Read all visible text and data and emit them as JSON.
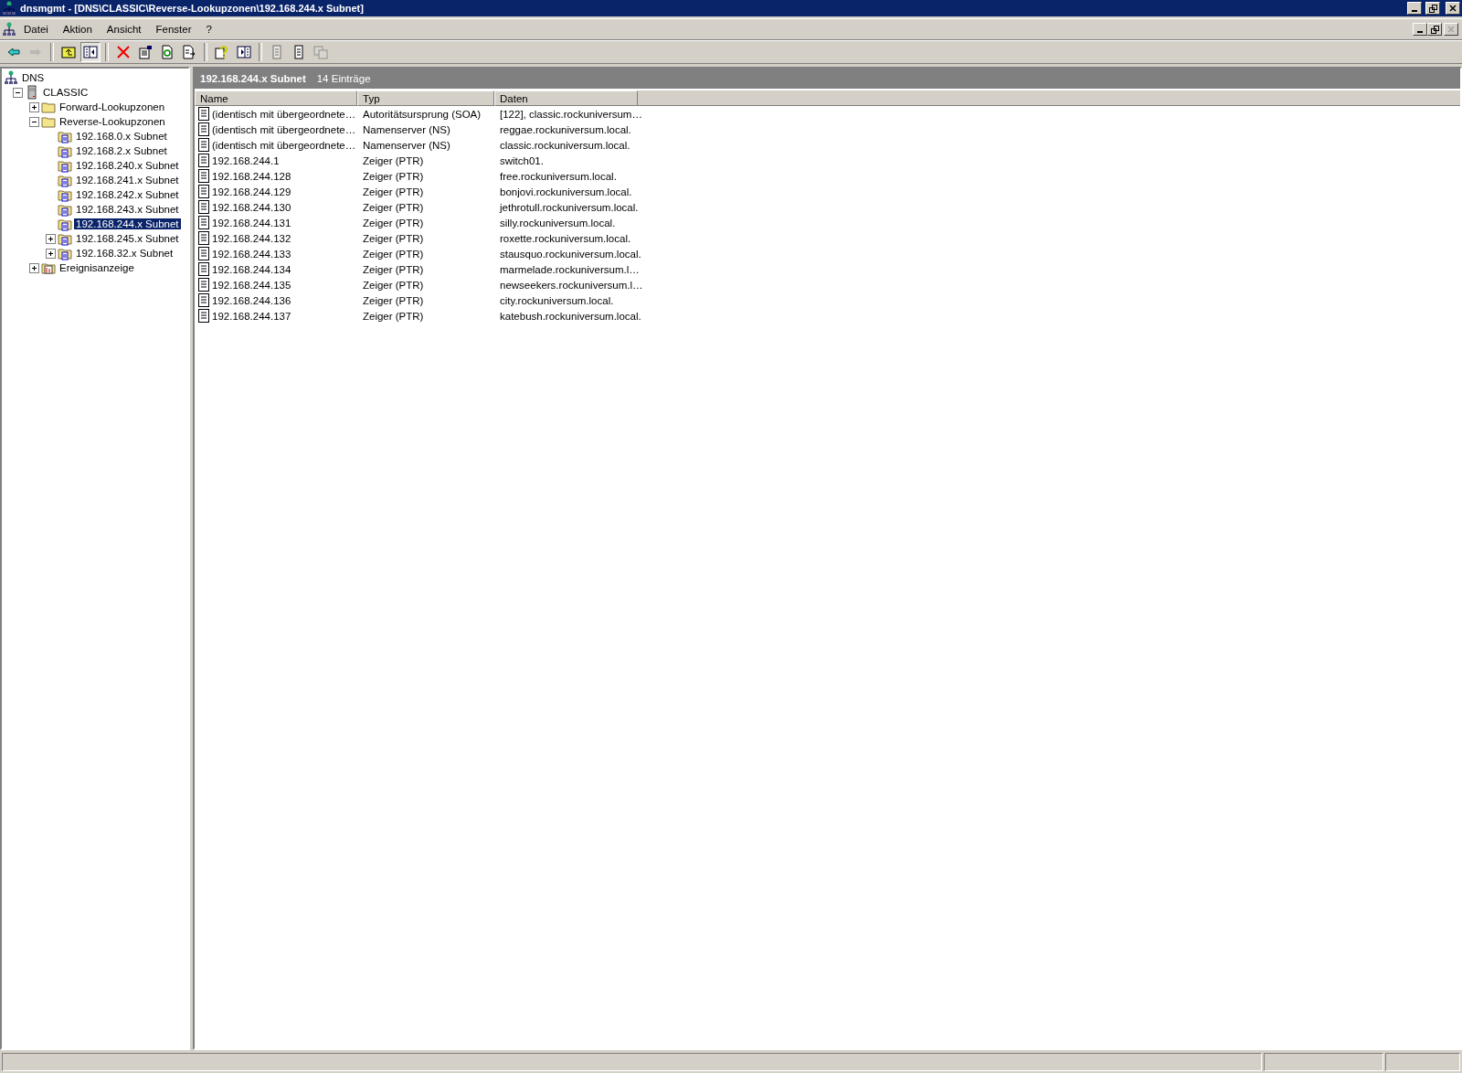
{
  "window": {
    "title": "dnsmgmt - [DNS\\CLASSIC\\Reverse-Lookupzonen\\192.168.244.x Subnet]"
  },
  "menu": [
    "Datei",
    "Aktion",
    "Ansicht",
    "Fenster",
    "?"
  ],
  "toolbar": [
    {
      "kind": "back",
      "disabled": false,
      "pressed": false
    },
    {
      "kind": "forward",
      "disabled": true,
      "pressed": false
    },
    {
      "kind": "sep"
    },
    {
      "kind": "up",
      "disabled": false,
      "pressed": false
    },
    {
      "kind": "tree",
      "disabled": false,
      "pressed": true
    },
    {
      "kind": "sep"
    },
    {
      "kind": "delete",
      "disabled": false,
      "pressed": false
    },
    {
      "kind": "properties",
      "disabled": false,
      "pressed": false
    },
    {
      "kind": "refresh",
      "disabled": false,
      "pressed": false
    },
    {
      "kind": "export",
      "disabled": false,
      "pressed": false
    },
    {
      "kind": "sep"
    },
    {
      "kind": "help",
      "disabled": false,
      "pressed": false
    },
    {
      "kind": "pane",
      "disabled": false,
      "pressed": false
    },
    {
      "kind": "sep"
    },
    {
      "kind": "record",
      "disabled": true,
      "pressed": false
    },
    {
      "kind": "record",
      "disabled": false,
      "pressed": false
    },
    {
      "kind": "copy",
      "disabled": true,
      "pressed": false
    }
  ],
  "tree": [
    {
      "label": "DNS",
      "kind": "root",
      "selected": false,
      "children": [
        {
          "label": "CLASSIC",
          "kind": "server",
          "selected": false,
          "expanded": true,
          "children": [
            {
              "label": "Forward-Lookupzonen",
              "kind": "folder",
              "selected": false,
              "expanded": false
            },
            {
              "label": "Reverse-Lookupzonen",
              "kind": "folder",
              "selected": false,
              "expanded": true,
              "children": [
                {
                  "label": "192.168.0.x Subnet",
                  "kind": "zone",
                  "selected": false
                },
                {
                  "label": "192.168.2.x Subnet",
                  "kind": "zone",
                  "selected": false
                },
                {
                  "label": "192.168.240.x Subnet",
                  "kind": "zone",
                  "selected": false
                },
                {
                  "label": "192.168.241.x Subnet",
                  "kind": "zone",
                  "selected": false
                },
                {
                  "label": "192.168.242.x Subnet",
                  "kind": "zone",
                  "selected": false
                },
                {
                  "label": "192.168.243.x Subnet",
                  "kind": "zone",
                  "selected": false
                },
                {
                  "label": "192.168.244.x Subnet",
                  "kind": "zone",
                  "selected": true
                },
                {
                  "label": "192.168.245.x Subnet",
                  "kind": "zone",
                  "selected": false,
                  "expanded": false
                },
                {
                  "label": "192.168.32.x Subnet",
                  "kind": "zone",
                  "selected": false,
                  "expanded": false
                }
              ]
            },
            {
              "label": "Ereignisanzeige",
              "kind": "events",
              "selected": false,
              "expanded": false
            }
          ]
        }
      ]
    }
  ],
  "pane_header": {
    "title": "192.168.244.x Subnet",
    "count": "14 Einträge"
  },
  "table": {
    "columns": [
      "Name",
      "Typ",
      "Daten"
    ],
    "rows": [
      [
        "(identisch mit übergeordnete…",
        "Autoritätsursprung (SOA)",
        "[122], classic.rockuniversum…"
      ],
      [
        "(identisch mit übergeordnete…",
        "Namenserver (NS)",
        "reggae.rockuniversum.local."
      ],
      [
        "(identisch mit übergeordnete…",
        "Namenserver (NS)",
        "classic.rockuniversum.local."
      ],
      [
        "192.168.244.1",
        "Zeiger (PTR)",
        "switch01."
      ],
      [
        "192.168.244.128",
        "Zeiger (PTR)",
        "free.rockuniversum.local."
      ],
      [
        "192.168.244.129",
        "Zeiger (PTR)",
        "bonjovi.rockuniversum.local."
      ],
      [
        "192.168.244.130",
        "Zeiger (PTR)",
        "jethrotull.rockuniversum.local."
      ],
      [
        "192.168.244.131",
        "Zeiger (PTR)",
        "silly.rockuniversum.local."
      ],
      [
        "192.168.244.132",
        "Zeiger (PTR)",
        "roxette.rockuniversum.local."
      ],
      [
        "192.168.244.133",
        "Zeiger (PTR)",
        "stausquo.rockuniversum.local."
      ],
      [
        "192.168.244.134",
        "Zeiger (PTR)",
        "marmelade.rockuniversum.l…"
      ],
      [
        "192.168.244.135",
        "Zeiger (PTR)",
        "newseekers.rockuniversum.l…"
      ],
      [
        "192.168.244.136",
        "Zeiger (PTR)",
        "city.rockuniversum.local."
      ],
      [
        "192.168.244.137",
        "Zeiger (PTR)",
        "katebush.rockuniversum.local."
      ]
    ]
  }
}
